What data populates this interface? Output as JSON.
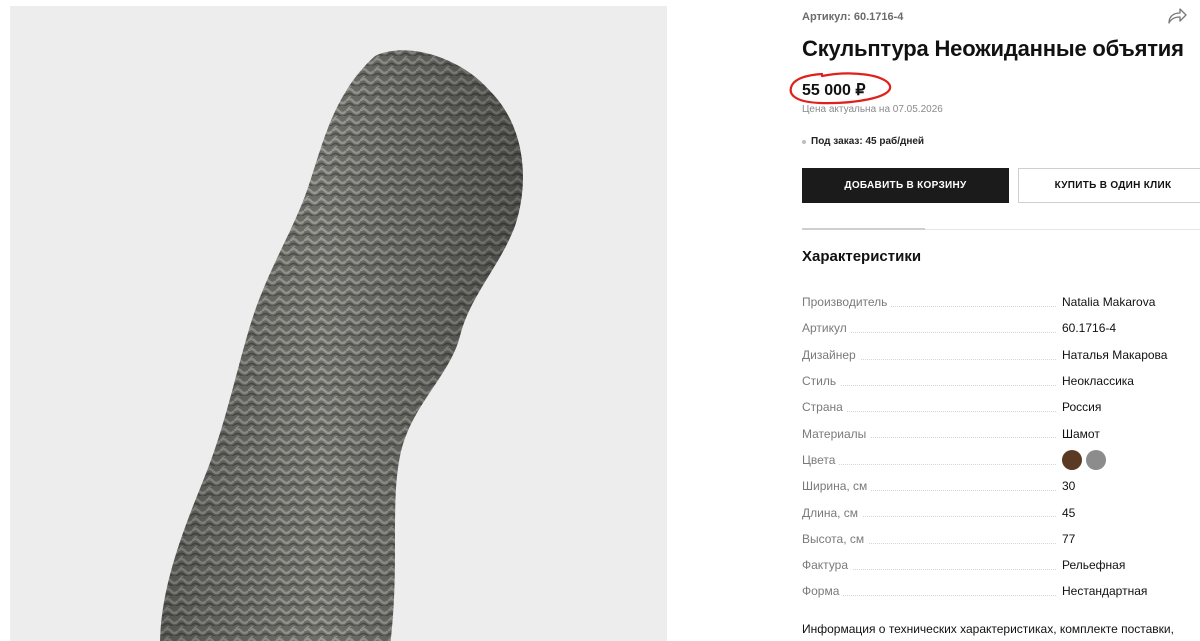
{
  "product": {
    "sku_label": "Артикул: 60.1716-4",
    "title": "Скульптура Неожиданные объятия",
    "price": "55 000 ₽",
    "price_note": "Цена актуальна на 07.05.2026",
    "availability": "Под заказ: 45 раб/дней"
  },
  "actions": {
    "add_to_cart": "ДОБАВИТЬ В КОРЗИНУ",
    "buy_one_click": "КУПИТЬ В ОДИН КЛИК",
    "share_icon": "share-icon"
  },
  "specs": {
    "title": "Характеристики",
    "rows": [
      {
        "name": "Производитель",
        "value": "Natalia Makarova"
      },
      {
        "name": "Артикул",
        "value": "60.1716-4"
      },
      {
        "name": "Дизайнер",
        "value": "Наталья Макарова"
      },
      {
        "name": "Стиль",
        "value": "Неоклассика"
      },
      {
        "name": "Страна",
        "value": "Россия"
      },
      {
        "name": "Материалы",
        "value": "Шамот"
      },
      {
        "name": "Цвета",
        "value": ""
      },
      {
        "name": "Ширина, см",
        "value": "30"
      },
      {
        "name": "Длина, см",
        "value": "45"
      },
      {
        "name": "Высота, см",
        "value": "77"
      },
      {
        "name": "Фактура",
        "value": "Рельефная"
      },
      {
        "name": "Форма",
        "value": "Нестандартная"
      }
    ],
    "colors": [
      "#5a3a22",
      "#8c8c8c"
    ]
  },
  "footnote": "Информация о технических характеристиках, комплекте поставки,",
  "theme": {
    "button_dark": "#1b1b1b",
    "highlight_circle": "#e0201b",
    "sculpture": "#6f6f6a"
  }
}
